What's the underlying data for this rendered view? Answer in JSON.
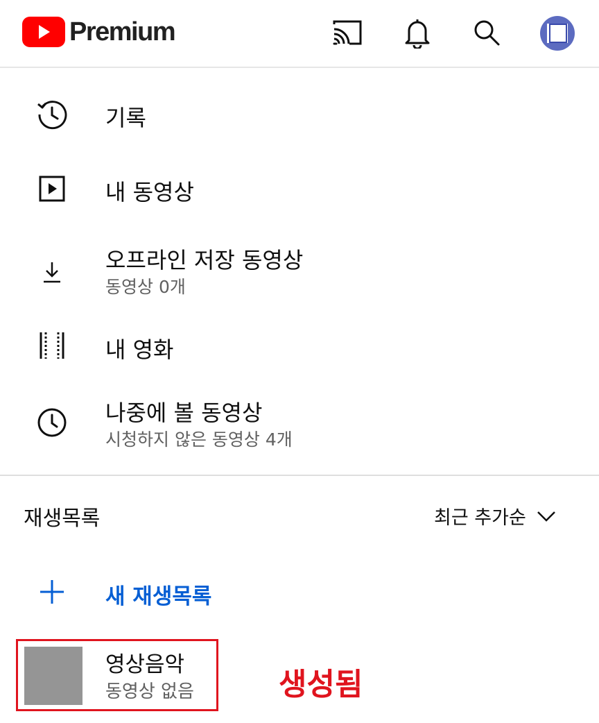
{
  "header": {
    "logo_text": "Premium",
    "brand_color": "#ff0000",
    "icons": [
      "cast-icon",
      "bell-icon",
      "search-icon",
      "avatar"
    ]
  },
  "menu": {
    "history": {
      "title": "기록",
      "icon": "history-icon"
    },
    "my_videos": {
      "title": "내 동영상",
      "icon": "play-square-icon"
    },
    "offline": {
      "title": "오프라인 저장 동영상",
      "subtitle": "동영상 0개",
      "icon": "download-icon"
    },
    "movies": {
      "title": "내 영화",
      "icon": "film-icon"
    },
    "watch_later": {
      "title": "나중에 볼 동영상",
      "subtitle": "시청하지 않은 동영상 4개",
      "icon": "clock-icon"
    }
  },
  "playlists": {
    "section_title": "재생목록",
    "sort_label": "최근 추가순",
    "new_playlist_label": "새 재생목록",
    "accent_color": "#065fd4",
    "items": [
      {
        "title": "영상음악",
        "subtitle": "동영상 없음"
      }
    ]
  },
  "annotation": {
    "text": "생성됨",
    "color": "#e0141e"
  }
}
